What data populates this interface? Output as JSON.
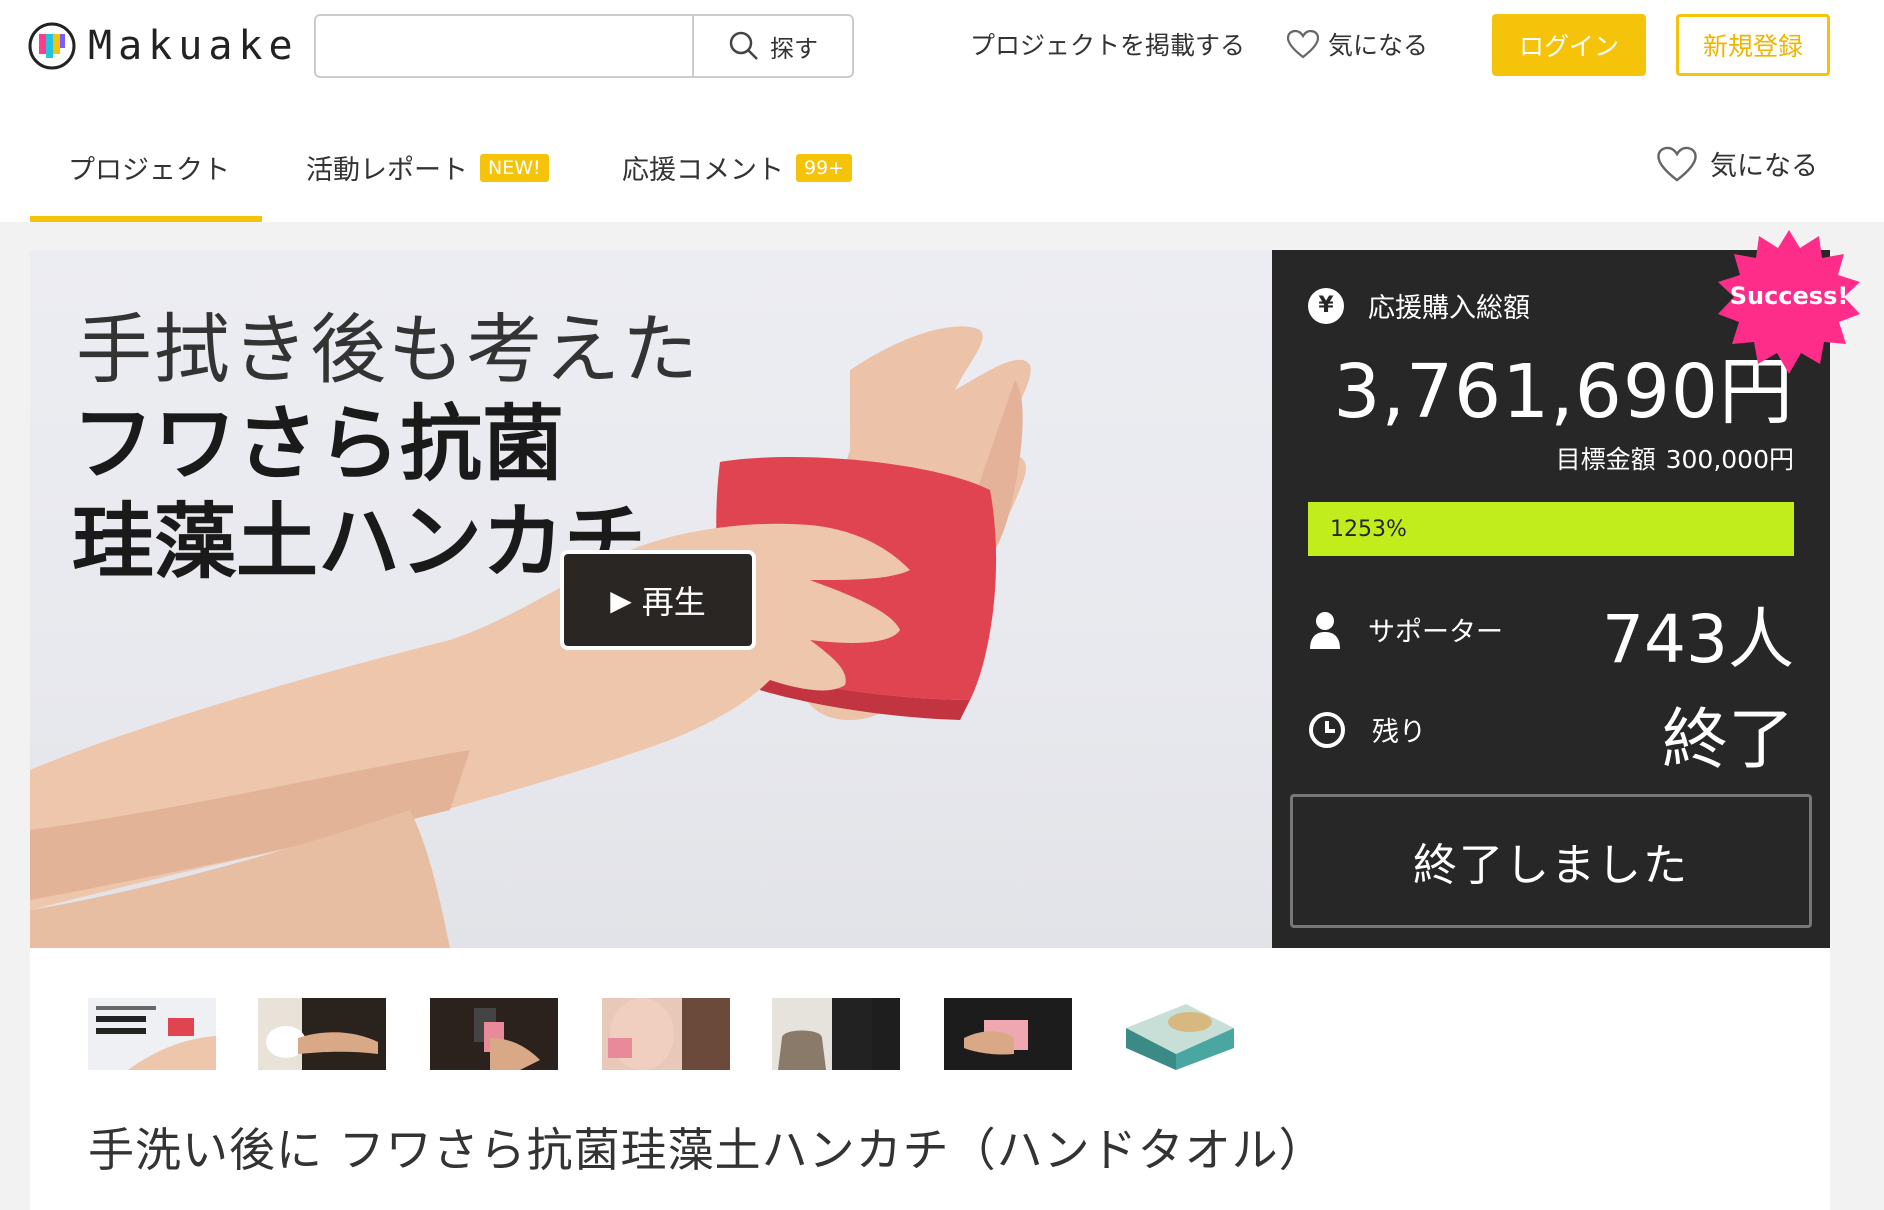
{
  "header": {
    "logo_text": "Makuake",
    "search_placeholder": "",
    "search_label": "探す",
    "post_project": "プロジェクトを掲載する",
    "favorite": "気になる",
    "login": "ログイン",
    "signup": "新規登録"
  },
  "tabs": {
    "project": "プロジェクト",
    "report": "活動レポート",
    "report_badge": "NEW!",
    "comments": "応援コメント",
    "comments_badge": "99+",
    "favorite": "気になる"
  },
  "hero": {
    "line1": "手拭き後も考えた",
    "line2": "フワさら抗菌",
    "line3": "珪藻土ハンカチ",
    "play_label": "再生"
  },
  "panel": {
    "total_label": "応援購入総額",
    "total_amount": "3,761,690円",
    "goal_label": "目標金額",
    "goal_amount": "300,000円",
    "percent": "1253%",
    "supporters_label": "サポーター",
    "supporters_value": "743人",
    "remaining_label": "残り",
    "remaining_value": "終了",
    "ended_button": "終了しました",
    "success_badge": "Success!"
  },
  "project": {
    "title": "手洗い後に フワさら抗菌珪藻土ハンカチ（ハンドタオル）"
  },
  "colors": {
    "accent": "#f5c40a",
    "panel_bg": "#272727",
    "progress": "#c2ed1c",
    "success": "#ff2d8a"
  }
}
